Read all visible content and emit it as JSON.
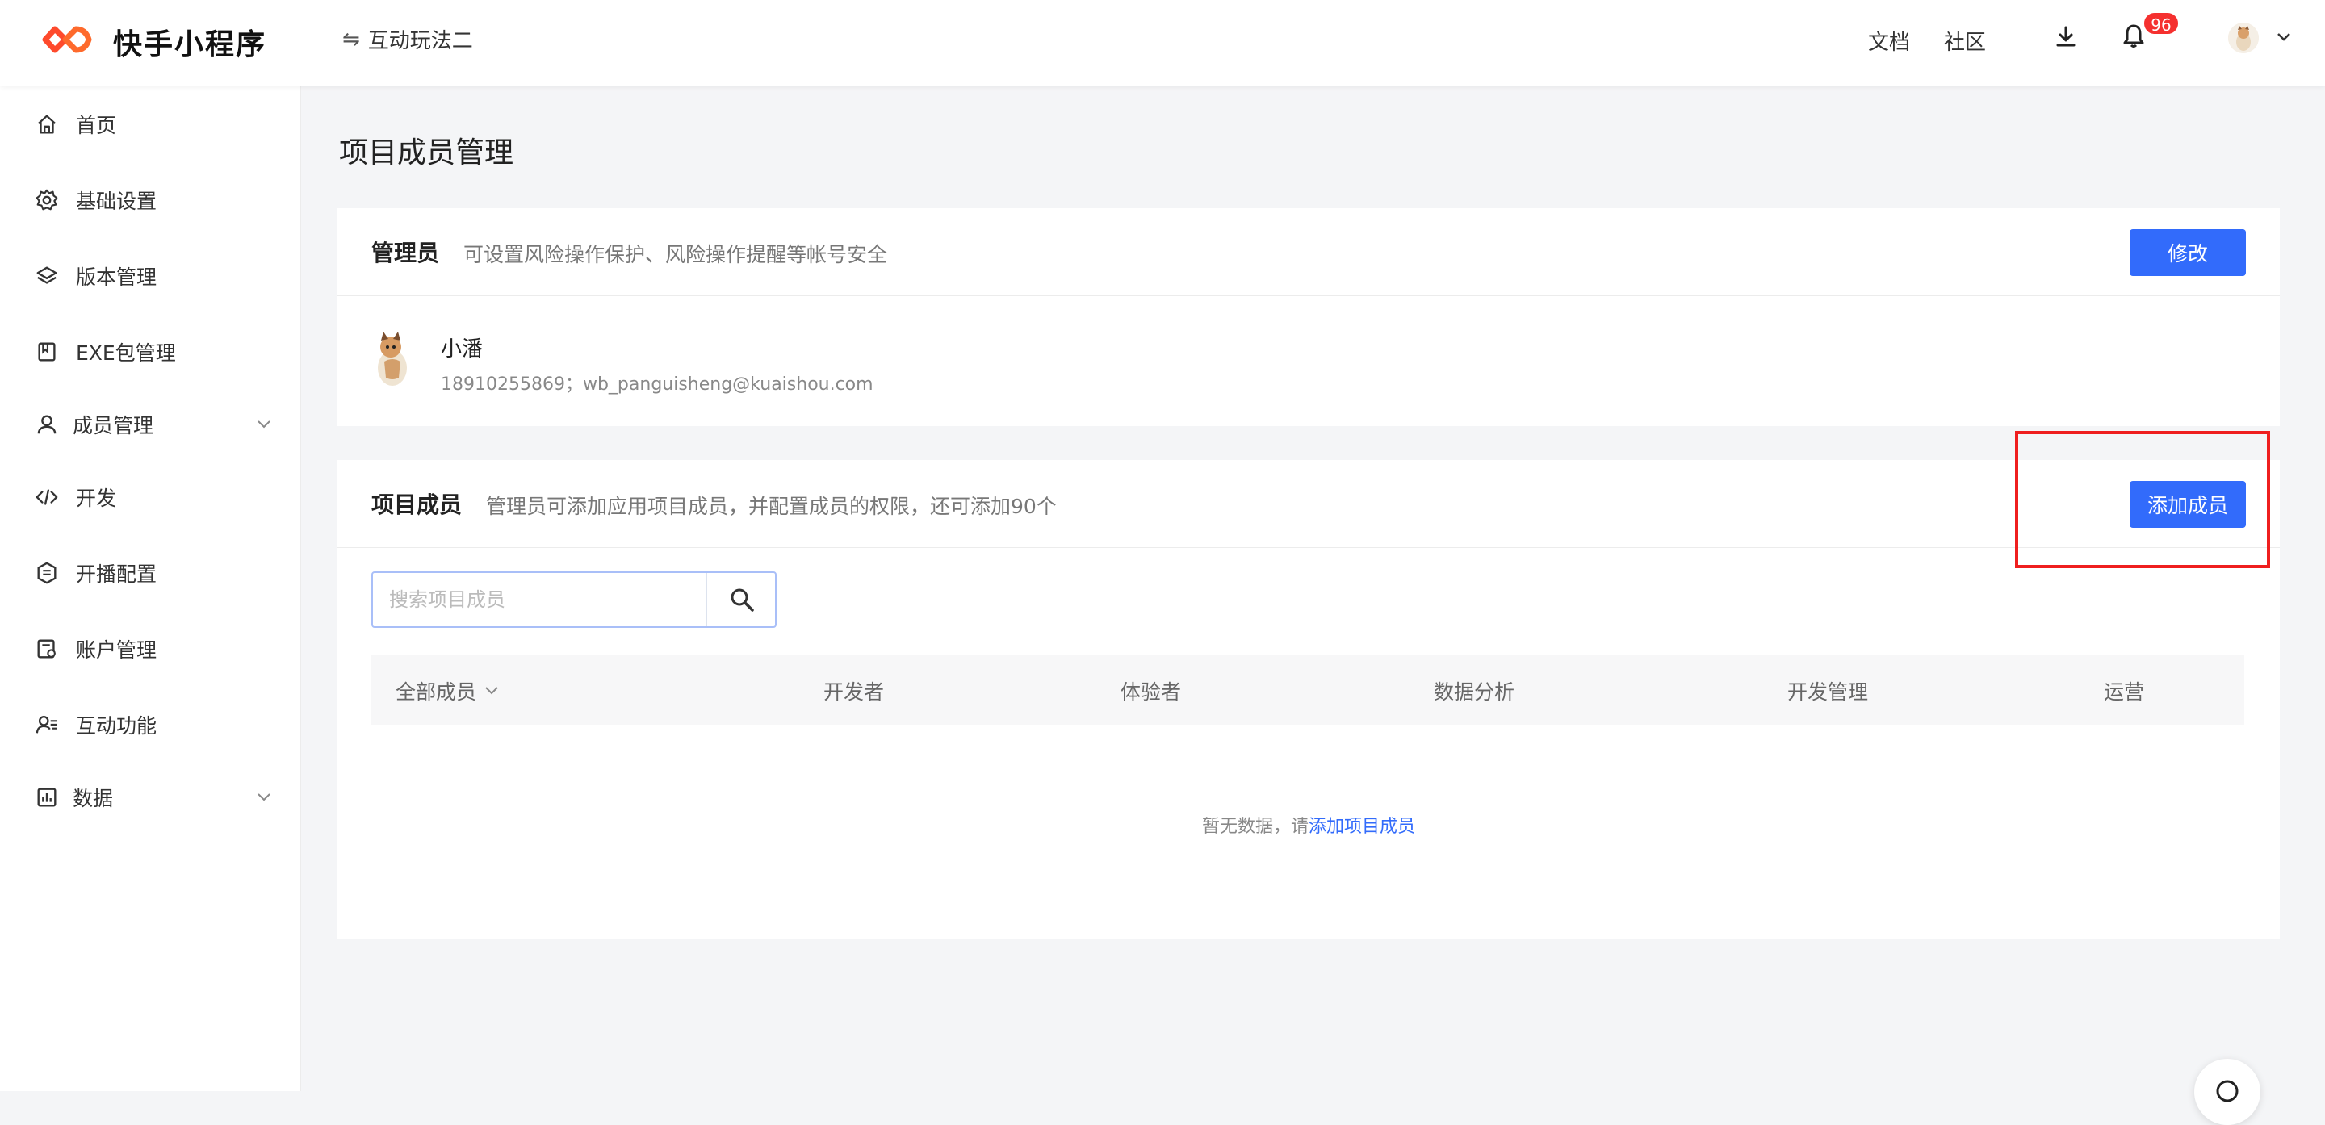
{
  "header": {
    "logo_text": "快手小程序",
    "project_name": "互动玩法二",
    "swap_icon": "⇋",
    "links": {
      "docs": "文档",
      "community": "社区"
    },
    "notification_count": "96",
    "colors": {
      "brand": "#fe3666",
      "badge": "#f5302f"
    }
  },
  "sidebar": {
    "items": [
      {
        "label": "首页",
        "icon": "home-icon"
      },
      {
        "label": "基础设置",
        "icon": "gear-icon"
      },
      {
        "label": "版本管理",
        "icon": "layers-icon"
      },
      {
        "label": "EXE包管理",
        "icon": "bookmark-icon"
      },
      {
        "label": "成员管理",
        "icon": "user-icon",
        "expandable": true
      },
      {
        "label": "开发",
        "icon": "code-icon"
      },
      {
        "label": "开播配置",
        "icon": "badge-icon"
      },
      {
        "label": "账户管理",
        "icon": "account-icon"
      },
      {
        "label": "互动功能",
        "icon": "user-list-icon"
      },
      {
        "label": "数据",
        "icon": "chart-icon",
        "expandable": true
      }
    ]
  },
  "main": {
    "page_title": "项目成员管理",
    "admin_card": {
      "title": "管理员",
      "description": "可设置风险操作保护、风险操作提醒等帐号安全",
      "edit_button": "修改",
      "admin": {
        "name": "小潘",
        "contact": "18910255869；wb_panguisheng@kuaishou.com"
      }
    },
    "members_card": {
      "title": "项目成员",
      "description": "管理员可添加应用项目成员，并配置成员的权限，还可添加90个",
      "add_button": "添加成员",
      "search_placeholder": "搜索项目成员",
      "table_headers": [
        "全部成员",
        "开发者",
        "体验者",
        "数据分析",
        "开发管理",
        "运营"
      ],
      "empty_text": "暂无数据，请",
      "empty_link": "添加项目成员"
    },
    "accent_color": "#326bfb"
  }
}
